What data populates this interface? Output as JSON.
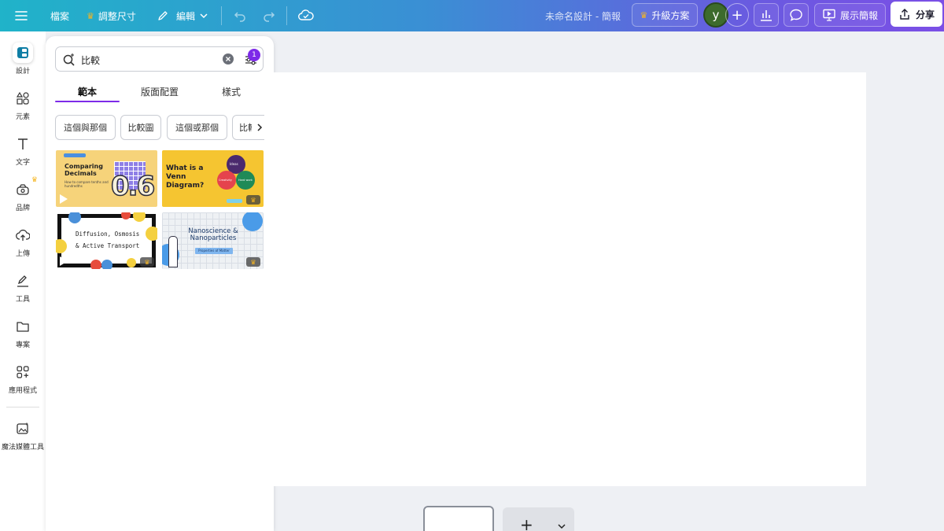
{
  "topbar": {
    "file": "檔案",
    "resize": "調整尺寸",
    "edit": "編輯",
    "title": "未命名設計 - 簡報",
    "upgrade": "升級方案",
    "avatar_letter": "y",
    "present": "展示簡報",
    "share": "分享"
  },
  "rail": {
    "design": "設計",
    "elements": "元素",
    "text": "文字",
    "brand": "品牌",
    "uploads": "上傳",
    "tools": "工具",
    "projects": "專案",
    "apps": "應用程式",
    "magic_media": "魔法媒體工具"
  },
  "panel": {
    "search_value": "比較",
    "filter_count": "1",
    "tabs": [
      "範本",
      "版面配置",
      "樣式"
    ],
    "chips": [
      "這個與那個",
      "比較圖",
      "這個或那個",
      "比較"
    ],
    "templates": {
      "t1_title": "Comparing Decimals",
      "t1_sub": "How to compare tenths and hundredths",
      "t1_digits": "0.6",
      "t2_title": "What is a Venn Diagram?",
      "t2_labels": [
        "Ideas",
        "Creativity",
        "Hard work"
      ],
      "t3_title": "Diffusion, Osmosis & Active Transport",
      "t4_title": "Nanoscience & Nanoparticles",
      "t4_sub": "Properties of Matter"
    }
  },
  "colors": {
    "accent": "#7d2ae8",
    "crown": "#f5b521",
    "avatar": "#3d6b2d"
  }
}
